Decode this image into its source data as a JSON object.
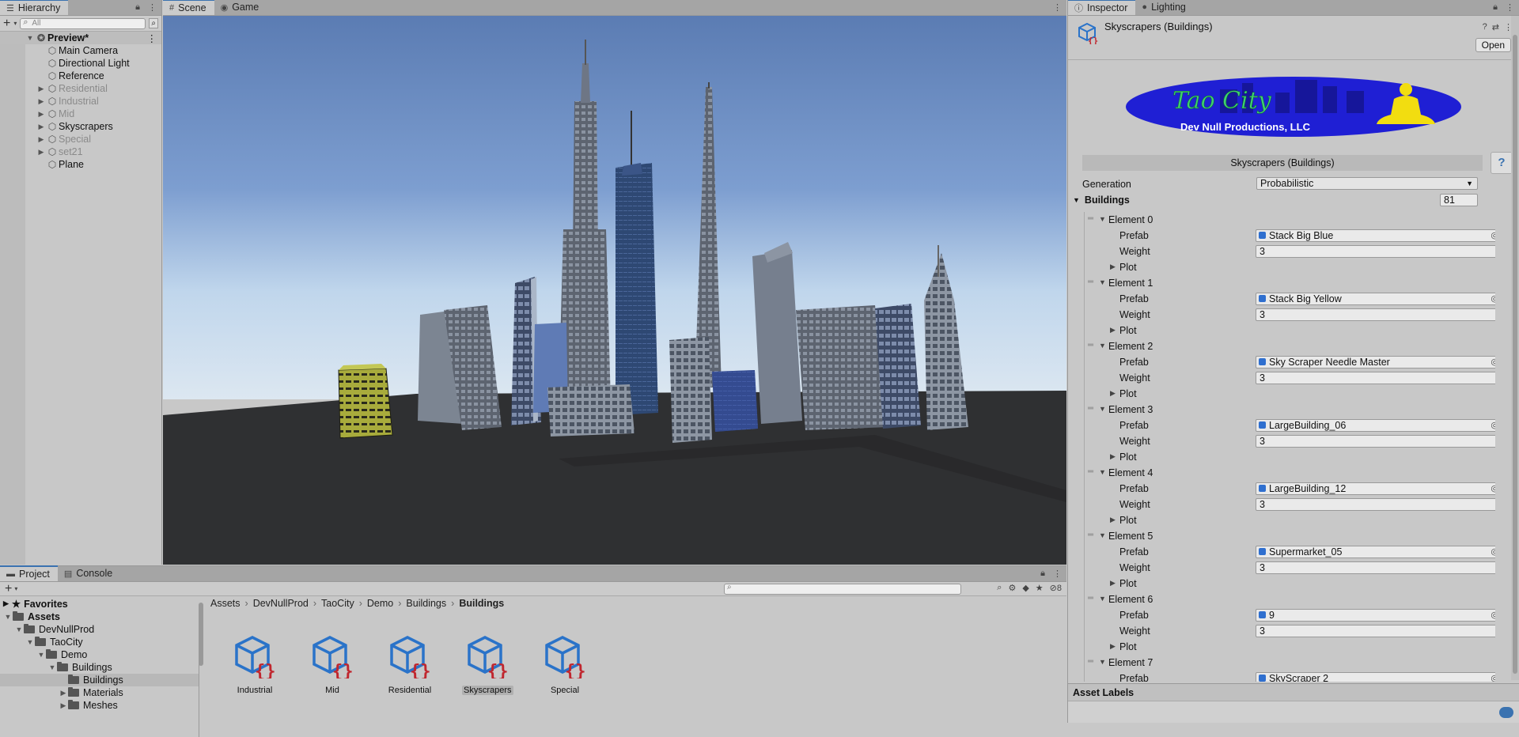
{
  "hierarchy": {
    "tab_label": "Hierarchy",
    "search_placeholder": "All",
    "scene_name": "Preview*",
    "items": [
      {
        "label": "Main Camera",
        "expandable": false,
        "dim": false
      },
      {
        "label": "Directional Light",
        "expandable": false,
        "dim": false
      },
      {
        "label": "Reference",
        "expandable": false,
        "dim": false
      },
      {
        "label": "Residential",
        "expandable": true,
        "dim": true
      },
      {
        "label": "Industrial",
        "expandable": true,
        "dim": true
      },
      {
        "label": "Mid",
        "expandable": true,
        "dim": true
      },
      {
        "label": "Skyscrapers",
        "expandable": true,
        "dim": false
      },
      {
        "label": "Special",
        "expandable": true,
        "dim": true
      },
      {
        "label": "set21",
        "expandable": true,
        "dim": true
      },
      {
        "label": "Plane",
        "expandable": false,
        "dim": false
      }
    ]
  },
  "scene": {
    "tabs": [
      {
        "label": "Scene",
        "icon": "grid-icon",
        "active": true
      },
      {
        "label": "Game",
        "icon": "gamepad-icon",
        "active": false
      }
    ],
    "colors": {
      "sky_top": "#5f80b6",
      "sky_bottom": "#b8d0ea",
      "ground": "#2e2f31"
    }
  },
  "inspector": {
    "tabs": [
      {
        "label": "Inspector",
        "icon": "info-icon",
        "active": true
      },
      {
        "label": "Lighting",
        "icon": "bulb-icon",
        "active": false
      }
    ],
    "title": "Skyscrapers (Buildings)",
    "open_label": "Open",
    "logo_title": "Tao City",
    "logo_subtitle": "Dev Null Productions, LLC",
    "section_title": "Skyscrapers (Buildings)",
    "help_label": "?",
    "generation_label": "Generation",
    "generation_value": "Probabilistic",
    "buildings_label": "Buildings",
    "buildings_count": "81",
    "prefab_label": "Prefab",
    "weight_label": "Weight",
    "plot_label": "Plot",
    "elements": [
      {
        "name": "Element 0",
        "prefab": "Stack Big Blue",
        "weight": "3"
      },
      {
        "name": "Element 1",
        "prefab": "Stack Big Yellow",
        "weight": "3"
      },
      {
        "name": "Element 2",
        "prefab": "Sky Scraper Needle Master",
        "weight": "3"
      },
      {
        "name": "Element 3",
        "prefab": "LargeBuilding_06",
        "weight": "3"
      },
      {
        "name": "Element 4",
        "prefab": "LargeBuilding_12",
        "weight": "3"
      },
      {
        "name": "Element 5",
        "prefab": "Supermarket_05",
        "weight": "3"
      },
      {
        "name": "Element 6",
        "prefab": "9",
        "weight": "3"
      },
      {
        "name": "Element 7",
        "prefab": "SkyScraper 2",
        "weight": ""
      }
    ],
    "asset_labels": "Asset Labels"
  },
  "project": {
    "tabs": [
      {
        "label": "Project",
        "icon": "folder-icon",
        "active": true
      },
      {
        "label": "Console",
        "icon": "console-icon",
        "active": false
      }
    ],
    "hidden_count": "8",
    "favorites_label": "Favorites",
    "tree": [
      {
        "label": "Assets",
        "depth": 0,
        "bold": true,
        "expanded": true,
        "selected": false
      },
      {
        "label": "DevNullProd",
        "depth": 1,
        "bold": false,
        "expanded": true,
        "selected": false
      },
      {
        "label": "TaoCity",
        "depth": 2,
        "bold": false,
        "expanded": true,
        "selected": false
      },
      {
        "label": "Demo",
        "depth": 3,
        "bold": false,
        "expanded": true,
        "selected": false
      },
      {
        "label": "Buildings",
        "depth": 4,
        "bold": false,
        "expanded": true,
        "selected": false
      },
      {
        "label": "Buildings",
        "depth": 5,
        "bold": false,
        "expanded": null,
        "selected": true
      },
      {
        "label": "Materials",
        "depth": 5,
        "bold": false,
        "expanded": false,
        "selected": false
      },
      {
        "label": "Meshes",
        "depth": 5,
        "bold": false,
        "expanded": false,
        "selected": false
      }
    ],
    "breadcrumb": [
      "Assets",
      "DevNullProd",
      "TaoCity",
      "Demo",
      "Buildings",
      "Buildings"
    ],
    "assets": [
      {
        "label": "Industrial",
        "selected": false
      },
      {
        "label": "Mid",
        "selected": false
      },
      {
        "label": "Residential",
        "selected": false
      },
      {
        "label": "Skyscrapers",
        "selected": true
      },
      {
        "label": "Special",
        "selected": false
      }
    ]
  }
}
